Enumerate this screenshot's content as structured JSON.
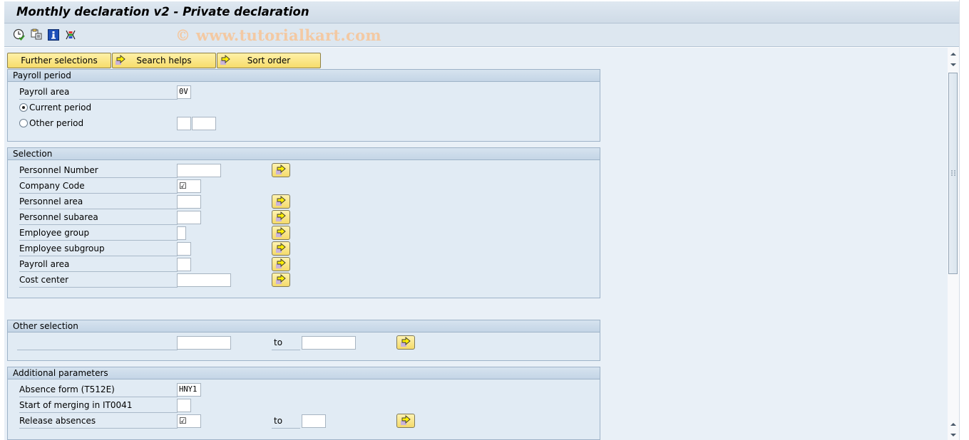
{
  "window": {
    "title": "Monthly declaration v2 - Private declaration",
    "watermark": "© www.tutorialkart.com"
  },
  "toolbar": {
    "icons": [
      "execute-clock-icon",
      "get-variant-icon",
      "info-icon",
      "selection-options-icon"
    ]
  },
  "buttons": {
    "further_selections": "Further selections",
    "search_helps": "Search helps",
    "sort_order": "Sort order"
  },
  "payroll_period": {
    "title": "Payroll period",
    "payroll_area_label": "Payroll area",
    "payroll_area_value": "0V",
    "current_period_label": "Current period",
    "current_period_selected": true,
    "other_period_label": "Other period",
    "other_period_selected": false,
    "other_period_value_1": "",
    "other_period_value_2": ""
  },
  "selection": {
    "title": "Selection",
    "rows": [
      {
        "label": "Personnel Number",
        "value": "",
        "has_multi": true
      },
      {
        "label": "Company Code",
        "value": "☑",
        "has_multi": false
      },
      {
        "label": "Personnel area",
        "value": "",
        "has_multi": true
      },
      {
        "label": "Personnel subarea",
        "value": "",
        "has_multi": true
      },
      {
        "label": "Employee group",
        "value": "",
        "has_multi": true
      },
      {
        "label": "Employee subgroup",
        "value": "",
        "has_multi": true
      },
      {
        "label": "Payroll area",
        "value": "",
        "has_multi": true
      },
      {
        "label": "Cost center",
        "value": "",
        "has_multi": true
      }
    ]
  },
  "other_selection": {
    "title": "Other selection",
    "label": "",
    "from_value": "",
    "to_label": "to",
    "to_value": ""
  },
  "additional_parameters": {
    "title": "Additional parameters",
    "absence_form_label": "Absence form (T512E)",
    "absence_form_value": "HNY1",
    "merge_start_label": "Start of merging in IT0041",
    "merge_start_value": "",
    "release_absences_label": "Release absences",
    "release_absences_value": "☑",
    "to_label": "to",
    "to_value": ""
  }
}
